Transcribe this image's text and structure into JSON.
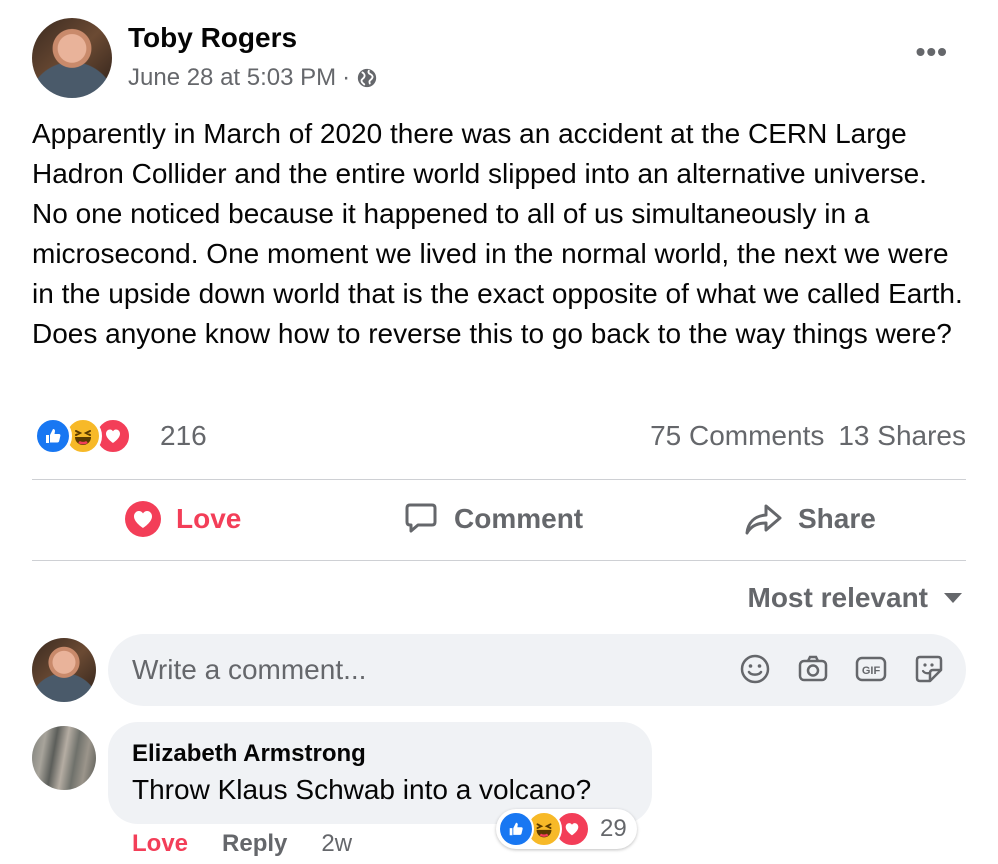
{
  "post": {
    "author": "Toby Rogers",
    "timestamp": "June 28 at 5:03 PM",
    "separator": "·",
    "audience_icon": "globe-icon",
    "more_label": "•••",
    "body": "Apparently in March of 2020 there was an accident at the CERN Large Hadron Collider and the entire world slipped into an alternative universe. No one noticed because it happened to all of us simultaneously in a microsecond. One moment we lived in the normal world, the next we were in the upside down world that is the exact opposite of what we called Earth. Does anyone know how to reverse this to go back to the way things were?"
  },
  "stats": {
    "reaction_icons": [
      "like-icon",
      "haha-icon",
      "love-icon"
    ],
    "reaction_count": "216",
    "comments": "75 Comments",
    "shares": "13 Shares"
  },
  "actions": {
    "love": "Love",
    "comment": "Comment",
    "share": "Share"
  },
  "sort": {
    "label": "Most relevant"
  },
  "composer": {
    "placeholder": "Write a comment...",
    "icons": [
      "emoji-icon",
      "camera-icon",
      "gif-icon",
      "sticker-icon"
    ]
  },
  "comments": [
    {
      "author": "Elizabeth Armstrong",
      "text": "Throw Klaus Schwab into a volcano?",
      "reaction_count": "29",
      "love_label": "Love",
      "reply_label": "Reply",
      "time": "2w"
    }
  ],
  "colors": {
    "accent_blue": "#1877f2",
    "love_red": "#f33e58",
    "haha_yellow": "#f7b928",
    "secondary_text": "#65676b",
    "bubble_bg": "#f0f2f5"
  }
}
